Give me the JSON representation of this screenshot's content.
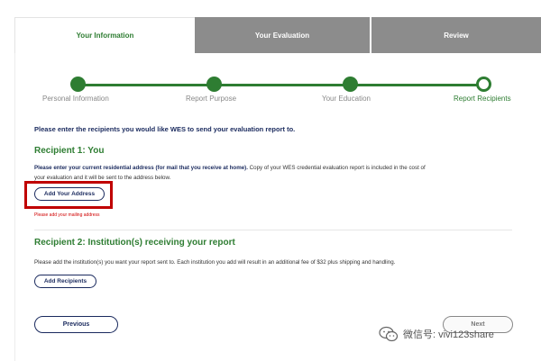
{
  "tabs": [
    {
      "label": "Your Information",
      "active": true
    },
    {
      "label": "Your Evaluation",
      "active": false
    },
    {
      "label": "Review",
      "active": false
    }
  ],
  "stepper": {
    "steps": [
      "Personal Information",
      "Report Purpose",
      "Your Education",
      "Report Recipients"
    ],
    "current_index": 3,
    "color": "#2e7d32"
  },
  "intro": "Please enter the recipients you would like WES to send your evaluation report to.",
  "recipient1": {
    "heading": "Recipient 1: You",
    "instruction_bold": "Please enter your current residential address (for mail that you receive at home).",
    "instruction_line1_rest": " Copy of your WES credential evaluation report is included in the cost of",
    "instruction_line2": "your evaluation and it will be sent to the address below.",
    "add_button": "Add Your Address",
    "error": "Please add your mailing address",
    "highlight_color": "#c00000"
  },
  "recipient2": {
    "heading": "Recipient 2: Institution(s) receiving your report",
    "instruction": "Please add the institution(s) you want your report sent to. Each institution you add will result in an additional fee of $32 plus shipping and handling.",
    "add_button": "Add Recipients"
  },
  "nav": {
    "previous": "Previous",
    "next": "Next"
  },
  "watermark": {
    "text": "微信号: vivi123share",
    "icon": "wechat-icon"
  }
}
